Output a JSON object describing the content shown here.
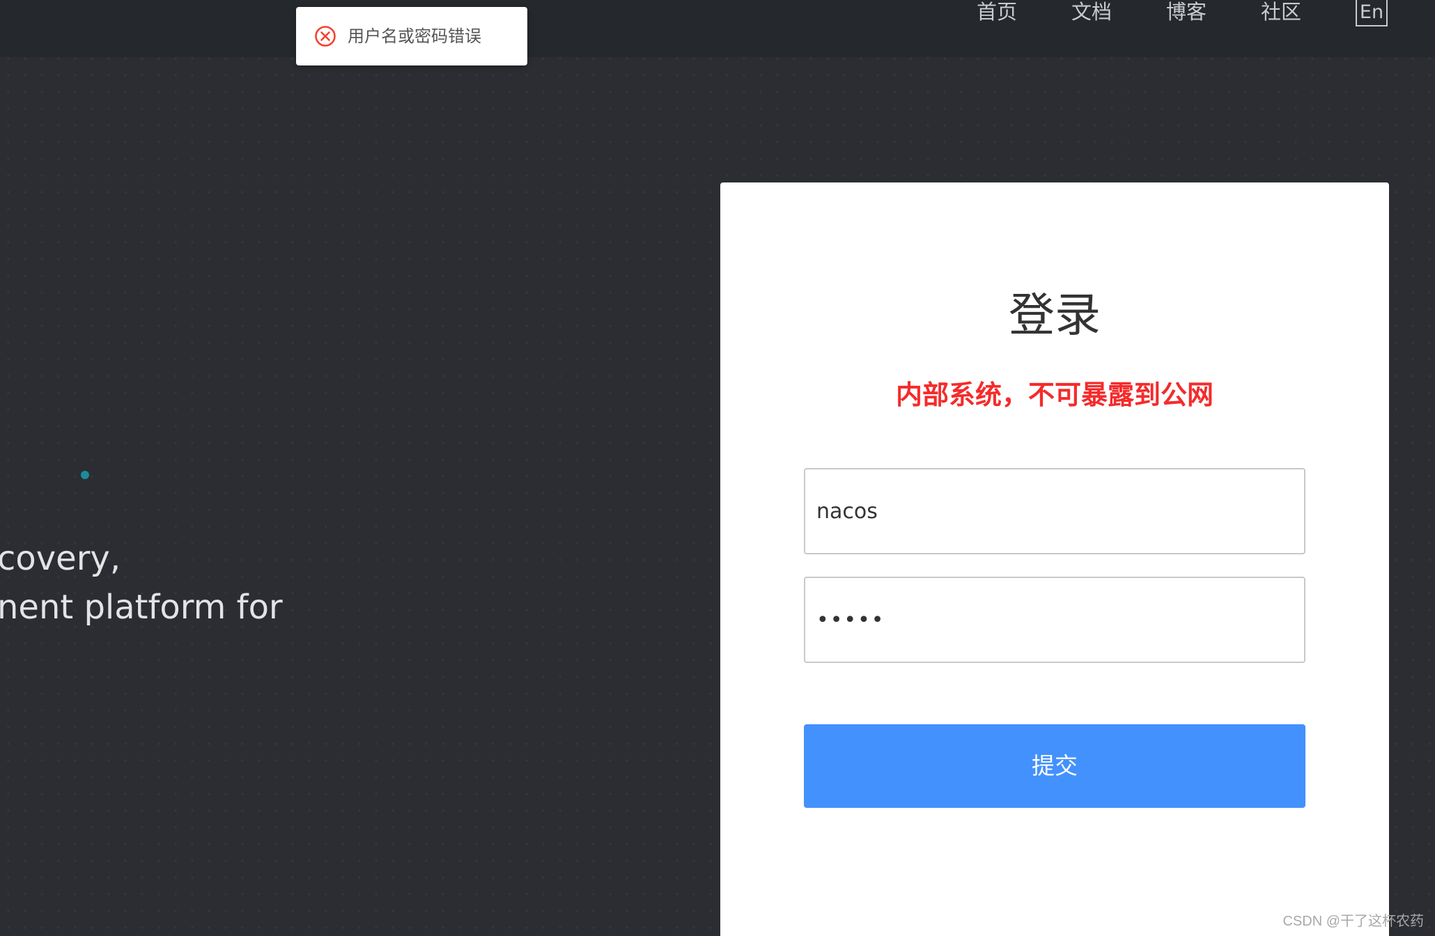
{
  "header": {
    "nav_items": [
      {
        "label": "首页"
      },
      {
        "label": "文档"
      },
      {
        "label": "博客"
      },
      {
        "label": "社区"
      }
    ],
    "language_toggle": "En"
  },
  "toast": {
    "message": "用户名或密码错误",
    "type": "error",
    "icon": "error-circle-icon",
    "color": "#f5412d"
  },
  "hero": {
    "line1": "covery,",
    "line2": "nent platform for"
  },
  "login": {
    "title": "登录",
    "warning": "内部系统，不可暴露到公网",
    "warning_color": "#f52b2b",
    "username_value": "nacos",
    "password_value": "nacos",
    "submit_label": "提交",
    "submit_color": "#4391fd"
  },
  "watermark": "CSDN @干了这杯农药"
}
